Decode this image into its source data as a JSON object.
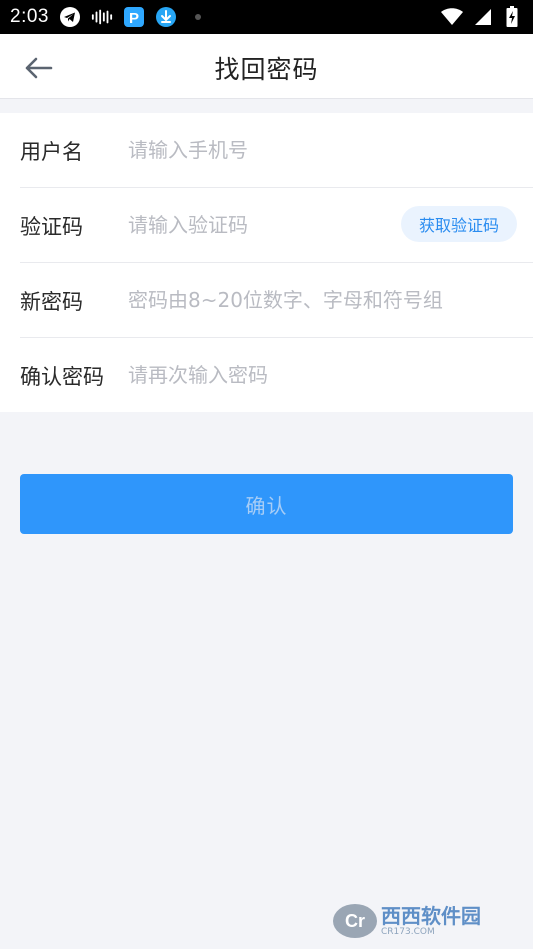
{
  "status_bar": {
    "time": "2:03",
    "icons": [
      "telegram-icon",
      "audio-wave-icon",
      "app-p-icon",
      "download-icon",
      "dot-icon"
    ],
    "right_icons": [
      "wifi-icon",
      "cellular-signal-icon",
      "battery-charging-icon"
    ]
  },
  "header": {
    "back_icon": "arrow-left-icon",
    "title": "找回密码"
  },
  "form": {
    "username": {
      "label": "用户名",
      "placeholder": "请输入手机号",
      "value": ""
    },
    "code": {
      "label": "验证码",
      "placeholder": "请输入验证码",
      "value": "",
      "get_code_label": "获取验证码"
    },
    "new_password": {
      "label": "新密码",
      "placeholder": "密码由8~20位数字、字母和符号组",
      "value": ""
    },
    "confirm_password": {
      "label": "确认密码",
      "placeholder": "请再次输入密码",
      "value": ""
    }
  },
  "confirm_button": {
    "label": "确认"
  },
  "watermark": {
    "logo": "Cr",
    "main": "西西软件园",
    "sub": "CR173.COM"
  },
  "colors": {
    "accent": "#2f96fb",
    "accent_text": "#a7cdf6",
    "code_btn_bg": "#eaf3fe",
    "code_btn_text": "#2a8cf0",
    "page_bg": "#f3f4f8"
  }
}
